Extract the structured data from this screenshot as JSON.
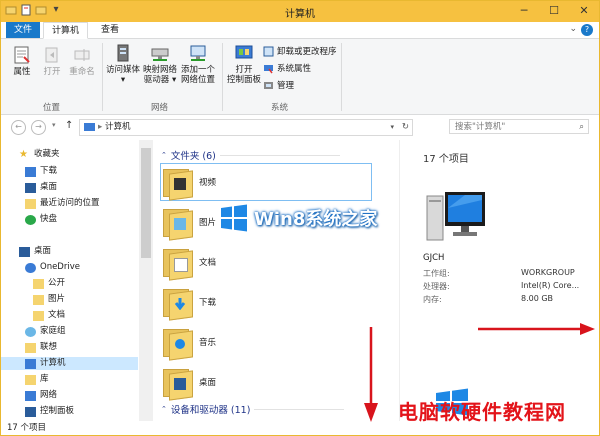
{
  "window": {
    "title": "计算机"
  },
  "tabs": {
    "file": "文件",
    "computer": "计算机",
    "view": "查看"
  },
  "ribbon": {
    "location_group": {
      "label": "位置",
      "properties": "属性",
      "open": "打开",
      "rename": "重命名"
    },
    "network_group": {
      "label": "网络",
      "access_media": "访问媒体",
      "map_drive_1": "映射网络",
      "map_drive_2": "驱动器",
      "add_location_1": "添加一个",
      "add_location_2": "网络位置"
    },
    "system_group": {
      "label": "系统",
      "open_cp_1": "打开",
      "open_cp_2": "控制面板",
      "uninstall": "卸载或更改程序",
      "sys_props": "系统属性",
      "manage": "管理"
    }
  },
  "address": {
    "path": "计算机",
    "search_placeholder": "搜索\"计算机\""
  },
  "nav": {
    "favorites": "收藏夹",
    "downloads": "下载",
    "desktop": "桌面",
    "recent": "最近访问的位置",
    "kuaipan": "快盘",
    "desktop_root": "桌面",
    "onedrive": "OneDrive",
    "public": "公开",
    "pictures": "图片",
    "documents": "文档",
    "homegroup": "家庭组",
    "lenovo": "联想",
    "computer": "计算机",
    "library": "库",
    "network": "网络",
    "control_panel": "控制面板"
  },
  "main": {
    "folders_header": "文件夹 (6)",
    "folders": [
      "视频",
      "图片",
      "文档",
      "下载",
      "音乐",
      "桌面"
    ],
    "devices_header": "设备和驱动器 (11)"
  },
  "details": {
    "count": "17 个项目",
    "computer_name": "GJCH",
    "workgroup_label": "工作组:",
    "workgroup_value": "WORKGROUP",
    "processor_label": "处理器:",
    "processor_value": "Intel(R) Core...",
    "memory_label": "内存:",
    "memory_value": "8.00 GB"
  },
  "status": {
    "count": "17 个项目"
  },
  "overlay": {
    "logo_text": "Win8系统之家",
    "watermark": "电脑软硬件教程网"
  },
  "colors": {
    "titlebar": "#f6c140",
    "accent": "#1979ca",
    "group_header": "#1e3287",
    "arrow": "#d8141c"
  }
}
